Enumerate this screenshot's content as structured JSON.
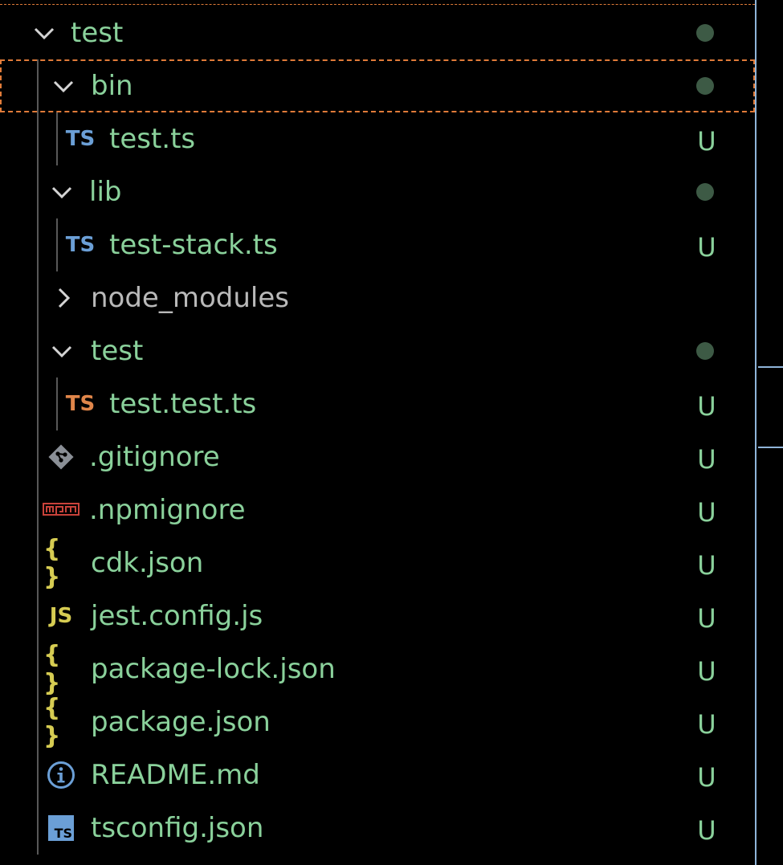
{
  "explorer": {
    "items": [
      {
        "label": "test",
        "badge": "",
        "dot": true,
        "kind": "folder-open"
      },
      {
        "label": "bin",
        "badge": "",
        "dot": true,
        "kind": "folder-open",
        "selected": true
      },
      {
        "label": "test.ts",
        "badge": "U",
        "kind": "file",
        "icon": "typescript-icon",
        "icon_text": "TS"
      },
      {
        "label": "lib",
        "badge": "",
        "dot": true,
        "kind": "folder-open"
      },
      {
        "label": "test-stack.ts",
        "badge": "U",
        "kind": "file",
        "icon": "typescript-icon",
        "icon_text": "TS"
      },
      {
        "label": "node_modules",
        "badge": "",
        "kind": "folder-closed"
      },
      {
        "label": "test",
        "badge": "",
        "dot": true,
        "kind": "folder-open"
      },
      {
        "label": "test.test.ts",
        "badge": "U",
        "kind": "file",
        "icon": "typescript-test-icon",
        "icon_text": "TS"
      },
      {
        "label": ".gitignore",
        "badge": "U",
        "kind": "file",
        "icon": "git-icon"
      },
      {
        "label": ".npmignore",
        "badge": "U",
        "kind": "file",
        "icon": "npm-icon"
      },
      {
        "label": "cdk.json",
        "badge": "U",
        "kind": "file",
        "icon": "json-icon",
        "icon_text": "{ }"
      },
      {
        "label": "jest.config.js",
        "badge": "U",
        "kind": "file",
        "icon": "javascript-icon",
        "icon_text": "JS"
      },
      {
        "label": "package-lock.json",
        "badge": "U",
        "kind": "file",
        "icon": "json-icon",
        "icon_text": "{ }"
      },
      {
        "label": "package.json",
        "badge": "U",
        "kind": "file",
        "icon": "json-icon",
        "icon_text": "{ }"
      },
      {
        "label": "README.md",
        "badge": "U",
        "kind": "file",
        "icon": "info-icon"
      },
      {
        "label": "tsconfig.json",
        "badge": "U",
        "kind": "file",
        "icon": "tsconfig-icon",
        "icon_text": "TS"
      }
    ]
  },
  "colors": {
    "untracked_text": "#8ad19b",
    "ignored_text": "#b9b9b9",
    "focus_outline": "#e07b39",
    "modified_dot": "#3d5a45",
    "ts_blue": "#6b9fd6",
    "ts_orange": "#e0864a",
    "json_yellow": "#d6cc52",
    "npm_red": "#c8423a",
    "background": "#000000"
  }
}
